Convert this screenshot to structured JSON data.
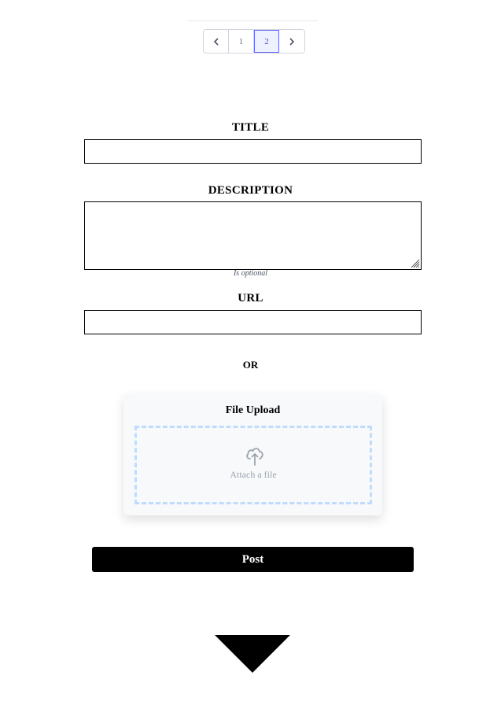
{
  "pagination": {
    "prev_icon": "chevron-left-icon",
    "next_icon": "chevron-right-icon",
    "pages": [
      "1",
      "2"
    ],
    "current_page": "2"
  },
  "form": {
    "title_label": "TITLE",
    "title_value": "",
    "description_label": "DESCRIPTION",
    "description_value": "",
    "description_hint": "Is optional",
    "url_label": "URL",
    "url_value": "",
    "or_label": "OR"
  },
  "upload": {
    "title": "File Upload",
    "icon": "cloud-upload-icon",
    "label": "Attach a file"
  },
  "actions": {
    "post_label": "Post"
  },
  "footer": {
    "icon": "triangle-down-icon"
  },
  "colors": {
    "active_page_bg": "#eef2ff",
    "active_page_border": "#6366f1",
    "dropzone_border": "#bfdbfe",
    "post_button_bg": "#000000"
  }
}
